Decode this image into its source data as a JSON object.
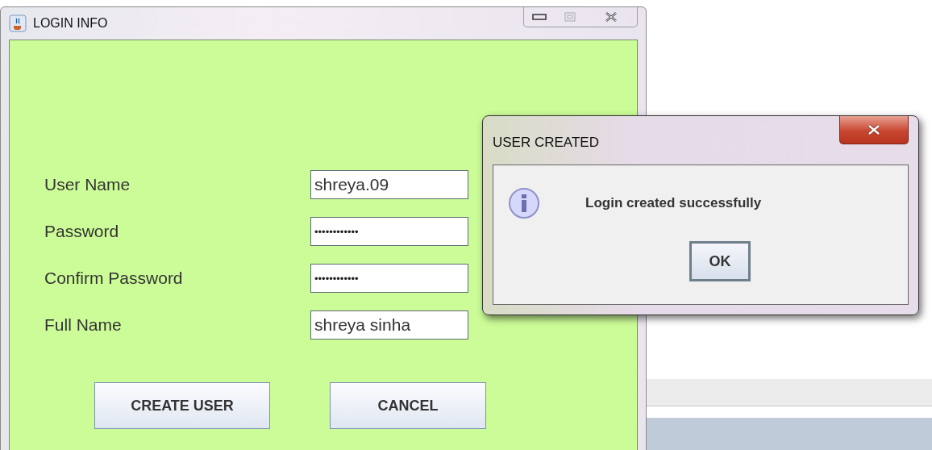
{
  "main_window": {
    "title": "LOGIN INFO",
    "fields": [
      {
        "label": "User Name",
        "value": "shreya.09",
        "kind": "text"
      },
      {
        "label": "Password",
        "value": "••••••••••••",
        "kind": "password"
      },
      {
        "label": "Confirm Password",
        "value": "••••••••••••",
        "kind": "password"
      },
      {
        "label": "Full Name",
        "value": "shreya sinha",
        "kind": "text"
      }
    ],
    "buttons": [
      "CREATE USER",
      "CANCEL"
    ]
  },
  "dialog": {
    "title": "USER CREATED",
    "message": "Login created successfully",
    "buttons": [
      "OK"
    ]
  }
}
